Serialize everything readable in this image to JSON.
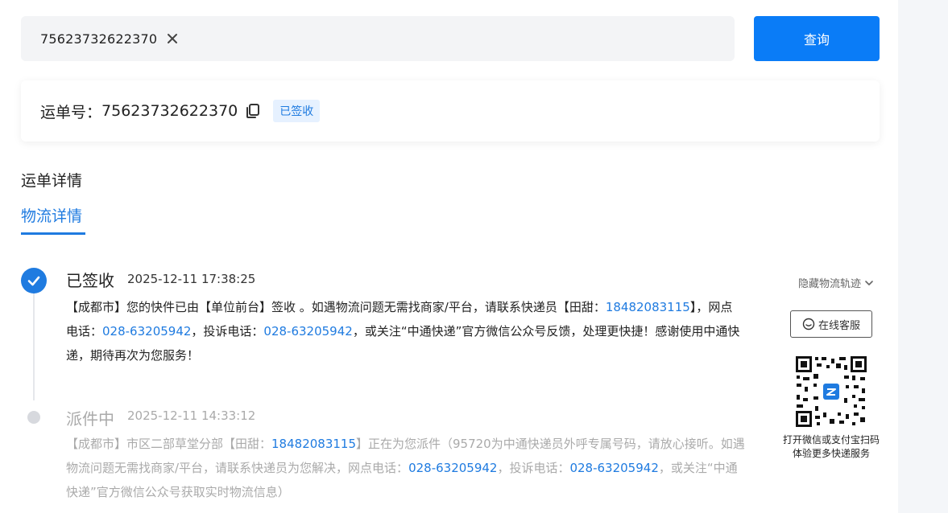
{
  "search": {
    "value": "75623732622370",
    "query_label": "查询"
  },
  "waybill": {
    "label": "运单号：",
    "number": "75623732622370",
    "status": "已签收"
  },
  "section_title": "运单详情",
  "tab_label": "物流详情",
  "events": [
    {
      "status": "已签收",
      "time": "2025-12-11 17:38:25",
      "desc": {
        "p1": "【成都市】您的快件已由【单位前台】签收 。如遇物流问题无需找商家/平台，请联系快递员【田甜：",
        "phone": "18482083115",
        "p2": "】，网点电话：",
        "site_phone": "028-63205942",
        "p3": "，投诉电话：",
        "complaint_phone": "028-63205942",
        "p4": "，或关注“中通快递”官方微信公众号反馈，处理更快捷！感谢使用中通快递，期待再次为您服务！"
      }
    },
    {
      "status": "派件中",
      "time": "2025-12-11 14:33:12",
      "desc": {
        "p1": "【成都市】市区二部草堂分部【田甜：",
        "phone": "18482083115",
        "p2": "】正在为您派件（95720为中通快递员外呼专属号码，请放心接听。如遇物流问题无需找商家/平台，请联系快递员为您解决，网点电话：",
        "site_phone": "028-63205942",
        "p3": "，投诉电话：",
        "complaint_phone": "028-63205942",
        "p4": "，或关注“中通快递”官方微信公众号获取实时物流信息）"
      }
    }
  ],
  "sidebar": {
    "hide_track": "隐藏物流轨迹",
    "service_label": "在线客服",
    "qr_caption_line1": "打开微信或支付宝扫码",
    "qr_caption_line2": "体验更多快递服务"
  },
  "colors": {
    "accent": "#1f7be0",
    "button": "#0a7cf7",
    "muted": "#aaaaaa"
  }
}
